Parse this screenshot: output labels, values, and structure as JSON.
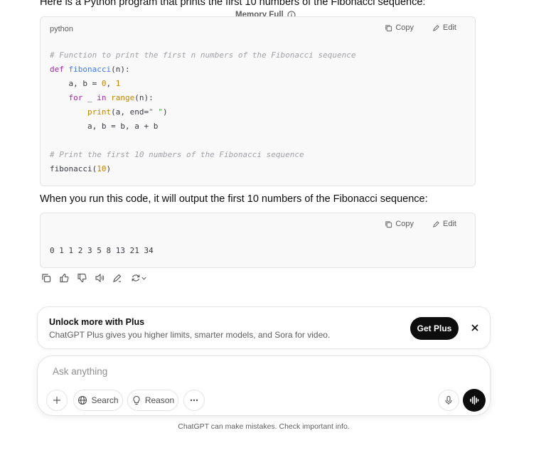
{
  "intro_text": "Here is a Python program that prints the first 10 numbers of the Fibonacci sequence:",
  "memory_label": "Memory Full",
  "code_block_1": {
    "language": "python",
    "copy_label": "Copy",
    "edit_label": "Edit"
  },
  "explanation_text": "When you run this code, it will output the first 10 numbers of the Fibonacci sequence:",
  "code_block_2": {
    "copy_label": "Copy",
    "edit_label": "Edit",
    "output": "0 1 1 2 3 5 8 13 21 34"
  },
  "upsell": {
    "title": "Unlock more with Plus",
    "subtitle": "ChatGPT Plus gives you higher limits, smarter models, and Sora for video.",
    "button_label": "Get Plus"
  },
  "composer": {
    "placeholder": "Ask anything",
    "search_label": "Search",
    "reason_label": "Reason"
  },
  "disclaimer": "ChatGPT can make mistakes. Check important info.",
  "icons": [
    "info-icon",
    "copy-icon",
    "edit-icon",
    "thumbs-up-icon",
    "thumbs-down-icon",
    "speaker-icon",
    "pen-icon",
    "regenerate-icon",
    "chevron-down-icon",
    "close-icon",
    "plus-icon",
    "globe-icon",
    "lightbulb-icon",
    "more-icon",
    "microphone-icon",
    "voice-icon"
  ]
}
